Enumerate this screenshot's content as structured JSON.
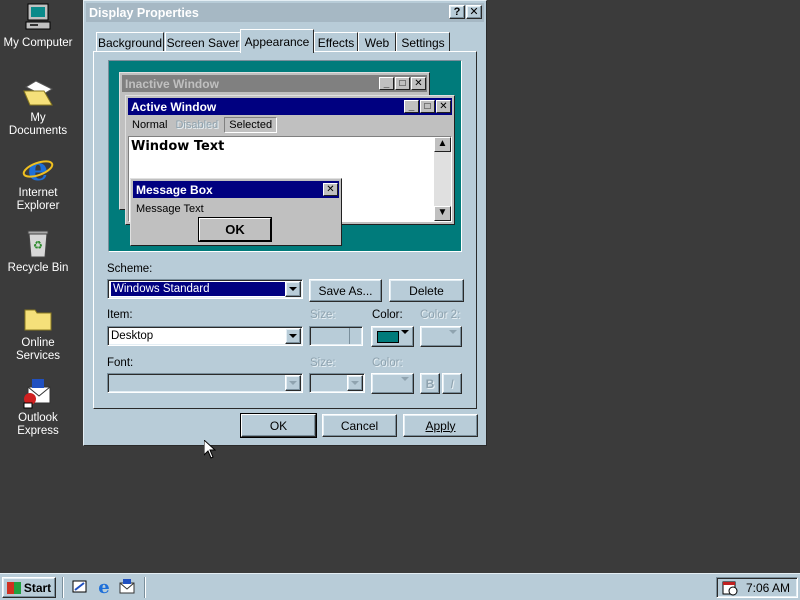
{
  "desktop": {
    "icons": [
      {
        "label": "My Computer",
        "icon": "computer-icon"
      },
      {
        "label": "My Documents",
        "icon": "folder-documents-icon"
      },
      {
        "label": "Internet Explorer",
        "icon": "internet-explorer-icon"
      },
      {
        "label": "Recycle Bin",
        "icon": "recycle-bin-icon"
      },
      {
        "label": "Online Services",
        "icon": "folder-icon"
      },
      {
        "label": "Outlook Express",
        "icon": "outlook-express-icon"
      }
    ]
  },
  "dialog": {
    "title": "Display Properties",
    "help_button": "?",
    "close_button": "✕",
    "tabs": [
      "Background",
      "Screen Saver",
      "Appearance",
      "Effects",
      "Web",
      "Settings"
    ],
    "active_tab": "Appearance",
    "preview": {
      "inactive_title": "Inactive Window",
      "active_title": "Active Window",
      "menu": [
        "Normal",
        "Disabled",
        "Selected"
      ],
      "window_text": "Window Text",
      "message_box_title": "Message Box",
      "message_text": "Message Text",
      "ok_label": "OK"
    },
    "scheme": {
      "label": "Scheme:",
      "value": "Windows Standard",
      "save_as": "Save As...",
      "delete": "Delete"
    },
    "item": {
      "label": "Item:",
      "value": "Desktop",
      "size_label": "Size:",
      "color_label": "Color:",
      "color2_label": "Color 2:",
      "color_value": "#007b7b"
    },
    "font": {
      "label": "Font:",
      "size_label": "Size:",
      "color_label": "Color:",
      "bold": "B",
      "italic": "I"
    },
    "buttons": {
      "ok": "OK",
      "cancel": "Cancel",
      "apply": "Apply"
    }
  },
  "taskbar": {
    "start": "Start",
    "quick_launch": [
      "desktop-icon",
      "internet-explorer-icon",
      "outlook-express-icon"
    ],
    "clock": "7:06 AM"
  },
  "colors": {
    "desktop": "#3b3b3b",
    "face": "#b8ccd8",
    "active_title": "#000080",
    "inactive_title": "#808080",
    "preview_desktop": "#007b7b"
  }
}
